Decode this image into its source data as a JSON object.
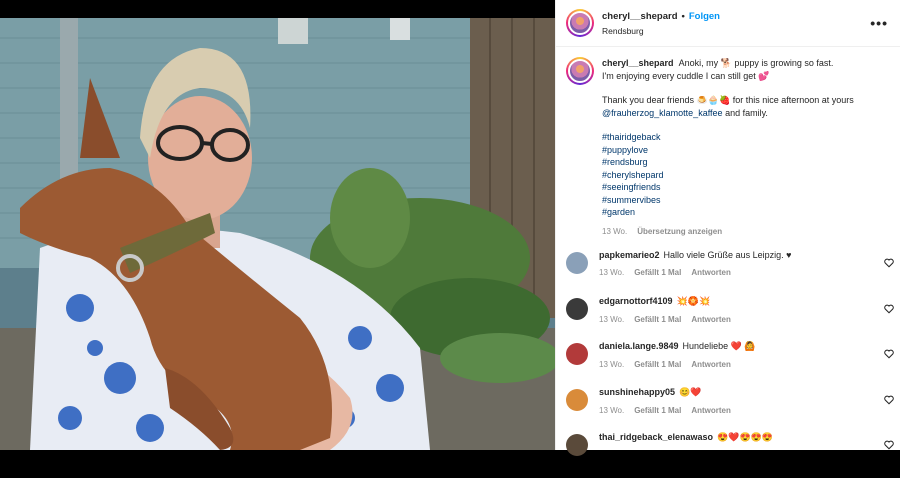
{
  "post": {
    "username": "cheryl__shepard",
    "dot": "•",
    "follow_label": "Folgen",
    "location": "Rendsburg",
    "more_icon": "more-horizontal-icon"
  },
  "caption": {
    "username": "cheryl__shepard",
    "line1a": "Anoki, my",
    "line1_emoji": "🐕",
    "line1b": "puppy is growing so fast.",
    "line2": "I'm enjoying every cuddle I can still get",
    "line2_emoji": "💕",
    "line3a": "Thank you dear friends",
    "line3_emoji": "🍮🧁🍓",
    "line3b": "for this nice afternoon at yours",
    "mention": "@frauherzog_klamotte_kaffee",
    "mention_suffix": "and family.",
    "hashtags": [
      "#thairidgeback",
      "#puppylove",
      "#rendsburg",
      "#cherylshepard",
      "#seeingfriends",
      "#summervibes",
      "#garden"
    ],
    "time": "13 Wo.",
    "translate": "Übersetzung anzeigen"
  },
  "comments": [
    {
      "username": "papkemarieo2",
      "text": "Hallo viele Grüße aus Leipzig. ♥",
      "time": "13 Wo.",
      "likes": "Gefällt 1 Mal",
      "reply": "Antworten",
      "avatar_color": "#8aa0b8"
    },
    {
      "username": "edgarnottorf4109",
      "text": "💥🏵️💥",
      "time": "13 Wo.",
      "likes": "Gefällt 1 Mal",
      "reply": "Antworten",
      "avatar_color": "#3a3a3a"
    },
    {
      "username": "daniela.lange.9849",
      "text": "Hundeliebe ❤️ 🙆",
      "time": "13 Wo.",
      "likes": "Gefällt 1 Mal",
      "reply": "Antworten",
      "avatar_color": "#b23a3a"
    },
    {
      "username": "sunshinehappy05",
      "text": "😊❤️",
      "time": "13 Wo.",
      "likes": "Gefällt 1 Mal",
      "reply": "Antworten",
      "avatar_color": "#d98b3a"
    },
    {
      "username": "thai_ridgeback_elenawaso",
      "text": "😍❤️😍😍😍",
      "time": "",
      "likes": "",
      "reply": "",
      "avatar_color": "#5a4a3a"
    }
  ],
  "colors": {
    "accent": "#0095f6",
    "link": "#00376b",
    "muted": "#8e8e8e"
  }
}
